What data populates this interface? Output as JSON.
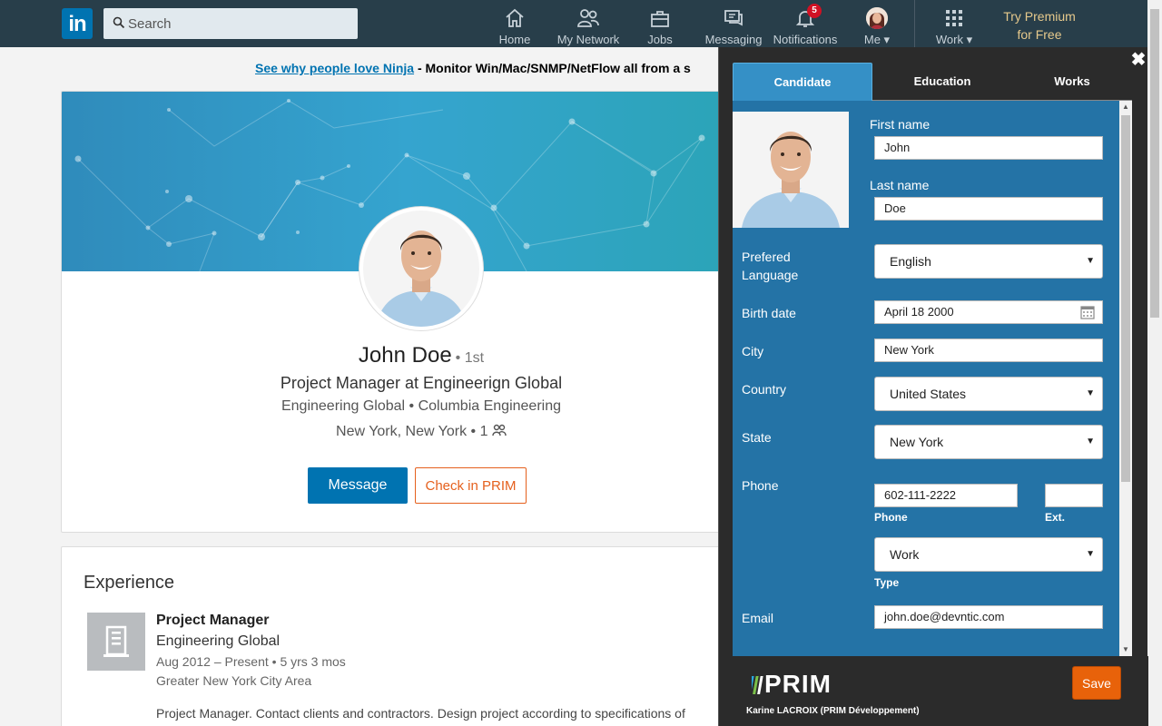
{
  "nav": {
    "logo": "in",
    "search_placeholder": "Search",
    "items": [
      {
        "label": "Home",
        "icon": "home-icon"
      },
      {
        "label": "My Network",
        "icon": "network-icon"
      },
      {
        "label": "Jobs",
        "icon": "briefcase-icon"
      },
      {
        "label": "Messaging",
        "icon": "messaging-icon"
      },
      {
        "label": "Notifications",
        "icon": "bell-icon",
        "badge": "5"
      },
      {
        "label": "Me ▾",
        "icon": "avatar"
      },
      {
        "label": "Work ▾",
        "icon": "grid-icon"
      }
    ],
    "premium_line1": "Try Premium",
    "premium_line2": "for Free"
  },
  "ad": {
    "link": "See why people love Ninja",
    "text": " - Monitor Win/Mac/SNMP/NetFlow all from a s"
  },
  "profile": {
    "name": "John Doe",
    "degree": "• 1st",
    "headline": "Project Manager at Engineerign Global",
    "companies": "Engineering Global • Columbia Engineering",
    "location": "New York, New York • 1",
    "message_button": "Message",
    "prim_button": "Check in PRIM"
  },
  "experience": {
    "title": "Experience",
    "role": "Project Manager",
    "company": "Engineering Global",
    "dates": "Aug 2012 – Present  • 5 yrs 3 mos",
    "area": "Greater New York City Area",
    "description": "Project Manager. Contact clients and contractors. Design project according to specifications of"
  },
  "prim": {
    "close": "✖",
    "tabs": [
      "Candidate",
      "Education",
      "Works"
    ],
    "active_tab": "Candidate",
    "fields": {
      "first_name_label": "First name",
      "first_name": "John",
      "last_name_label": "Last name",
      "last_name": "Doe",
      "language_label_1": "Prefered",
      "language_label_2": "Language",
      "language": "English",
      "birth_label": "Birth date",
      "birth": "April 18 2000",
      "city_label": "City",
      "city": "New York",
      "country_label": "Country",
      "country": "United States",
      "state_label": "State",
      "state": "New York",
      "phone_label": "Phone",
      "phone": "602-111-2222",
      "phone_sub": "Phone",
      "ext": "",
      "ext_sub": "Ext.",
      "phone_type": "Work",
      "type_sub": "Type",
      "email_label": "Email",
      "email": "john.doe@devntic.com"
    },
    "logo": "PRIM",
    "user": "Karine LACROIX (PRIM Développement)",
    "save": "Save"
  },
  "colors": {
    "nav_bg": "#283e4a",
    "brand_blue": "#0073b1",
    "prim_orange": "#e8620a",
    "panel_blue": "#2473a6"
  }
}
